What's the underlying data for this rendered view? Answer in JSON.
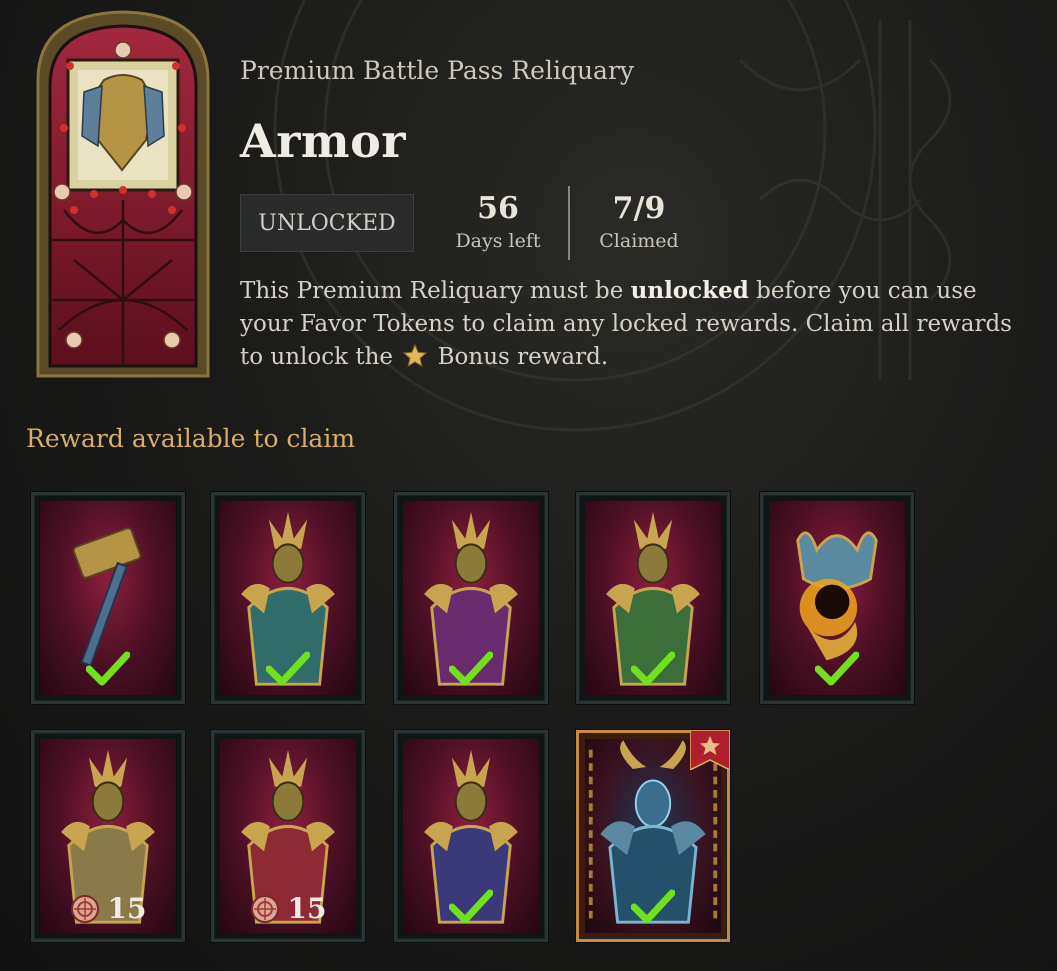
{
  "header": {
    "subtitle": "Premium Battle Pass Reliquary",
    "title": "Armor",
    "status": "UNLOCKED",
    "days_value": "56",
    "days_label": "Days left",
    "claimed_value": "7/9",
    "claimed_label": "Claimed",
    "description_part1": "This Premium Reliquary must be ",
    "description_bold": "unlocked",
    "description_part2": " before you can use your Favor Tokens to claim any locked rewards. Claim all rewards to unlock the ",
    "description_part3": " Bonus reward."
  },
  "section_title": "Reward available to claim",
  "rewards": [
    {
      "item": "hammer-weapon",
      "state": "claimed"
    },
    {
      "item": "armor-teal",
      "state": "claimed"
    },
    {
      "item": "armor-violet",
      "state": "claimed"
    },
    {
      "item": "armor-green",
      "state": "claimed"
    },
    {
      "item": "crown-headpiece",
      "state": "claimed"
    },
    {
      "item": "armor-gold",
      "state": "locked",
      "cost": "15"
    },
    {
      "item": "armor-crimson",
      "state": "locked",
      "cost": "15"
    },
    {
      "item": "armor-navy",
      "state": "claimed"
    },
    {
      "item": "armor-bonus-demon",
      "state": "claimed",
      "bonus": true
    }
  ],
  "colors": {
    "accent_gold": "#d9ae68",
    "check_green": "#6fe11d",
    "reward_bg": "#8a1f3c",
    "bonus_border": "#c98a3d"
  },
  "icons": [
    "check-icon",
    "favor-token-icon",
    "star-icon",
    "bonus-star-flag-icon",
    "stained-glass-window"
  ]
}
